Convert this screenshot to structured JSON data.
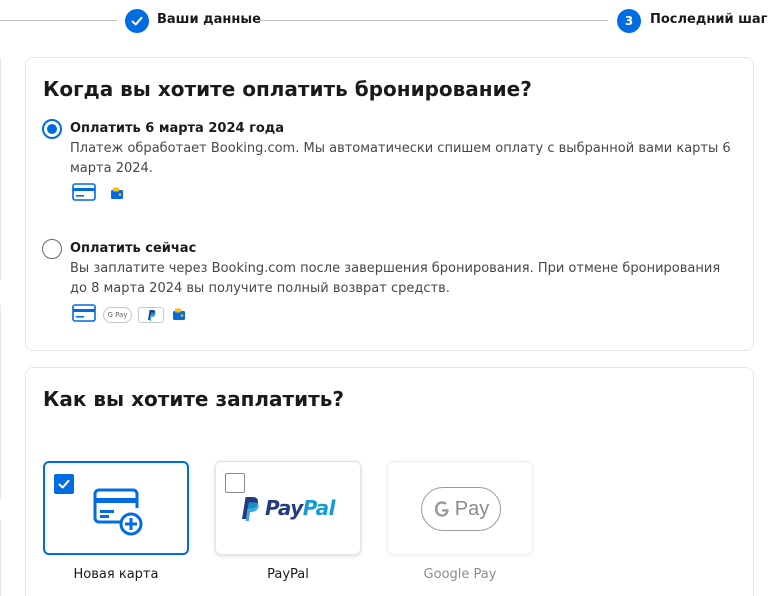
{
  "stepper": {
    "step2": {
      "label": "Ваши данные",
      "done": true
    },
    "step3": {
      "number": "3",
      "label": "Последний шаг"
    }
  },
  "when_pay": {
    "title": "Когда вы хотите оплатить бронирование?",
    "options": [
      {
        "title": "Оплатить 6 марта 2024 года",
        "description": "Платеж обработает Booking.com. Мы автоматически спишем оплату с выбранной вами карты 6 марта 2024.",
        "selected": true,
        "icons": [
          "credit-card-icon",
          "wallet-icon"
        ]
      },
      {
        "title": "Оплатить сейчас",
        "description": "Вы заплатите через Booking.com после завершения бронирования. При отмене бронирования до 8 марта 2024 вы получите полный возврат средств.",
        "selected": false,
        "icons": [
          "credit-card-icon",
          "google-pay-icon",
          "paypal-icon",
          "wallet-icon"
        ]
      }
    ]
  },
  "how_pay": {
    "title": "Как вы хотите заплатить?",
    "methods": [
      {
        "label": "Новая карта",
        "selected": true,
        "disabled": false,
        "icon": "new-card-icon"
      },
      {
        "label": "PayPal",
        "selected": false,
        "disabled": false,
        "icon": "paypal-logo"
      },
      {
        "label": "Google Pay",
        "selected": false,
        "disabled": true,
        "icon": "google-pay-logo"
      }
    ]
  },
  "icon_text": {
    "gpay_small": "G Pay",
    "gpay_large": "Pay",
    "paypal_pay": "Pay",
    "paypal_pal": "Pal"
  },
  "colors": {
    "accent": "#006ce4",
    "paypal_dark": "#253b80",
    "paypal_light": "#179bd7",
    "disabled_text": "#8c8c8c",
    "wallet_yellow": "#febb02"
  }
}
